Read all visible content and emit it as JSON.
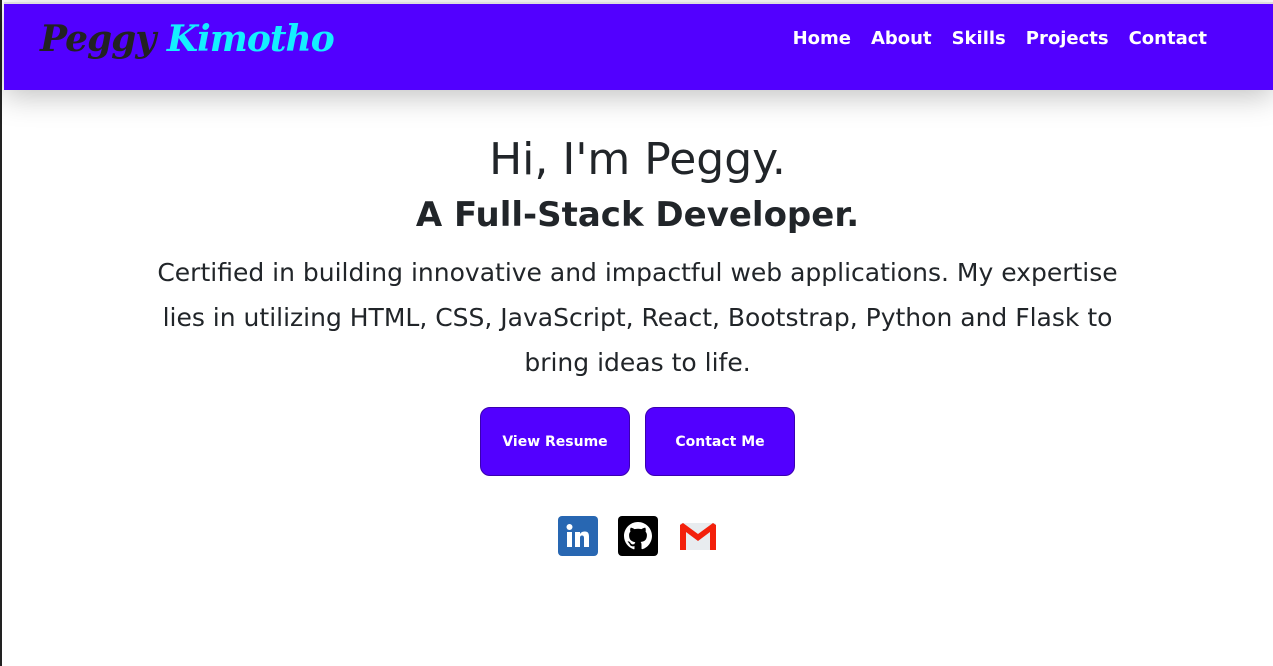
{
  "logo": {
    "first": "Peggy",
    "last": "Kimotho"
  },
  "nav": [
    "Home",
    "About",
    "Skills",
    "Projects",
    "Contact"
  ],
  "hero": {
    "greeting": "Hi, I'm Peggy.",
    "role": "A Full-Stack Developer.",
    "description": "Certified in building innovative and impactful web applications. My expertise lies in utilizing HTML, CSS, JavaScript, React, Bootstrap, Python and Flask to bring ideas to life.",
    "buttons": [
      "View Resume",
      "Contact Me"
    ]
  },
  "social": [
    "linkedin-icon",
    "github-icon",
    "gmail-icon"
  ],
  "colors": {
    "brand": "#5200ff",
    "accent": "#14f0ff"
  }
}
